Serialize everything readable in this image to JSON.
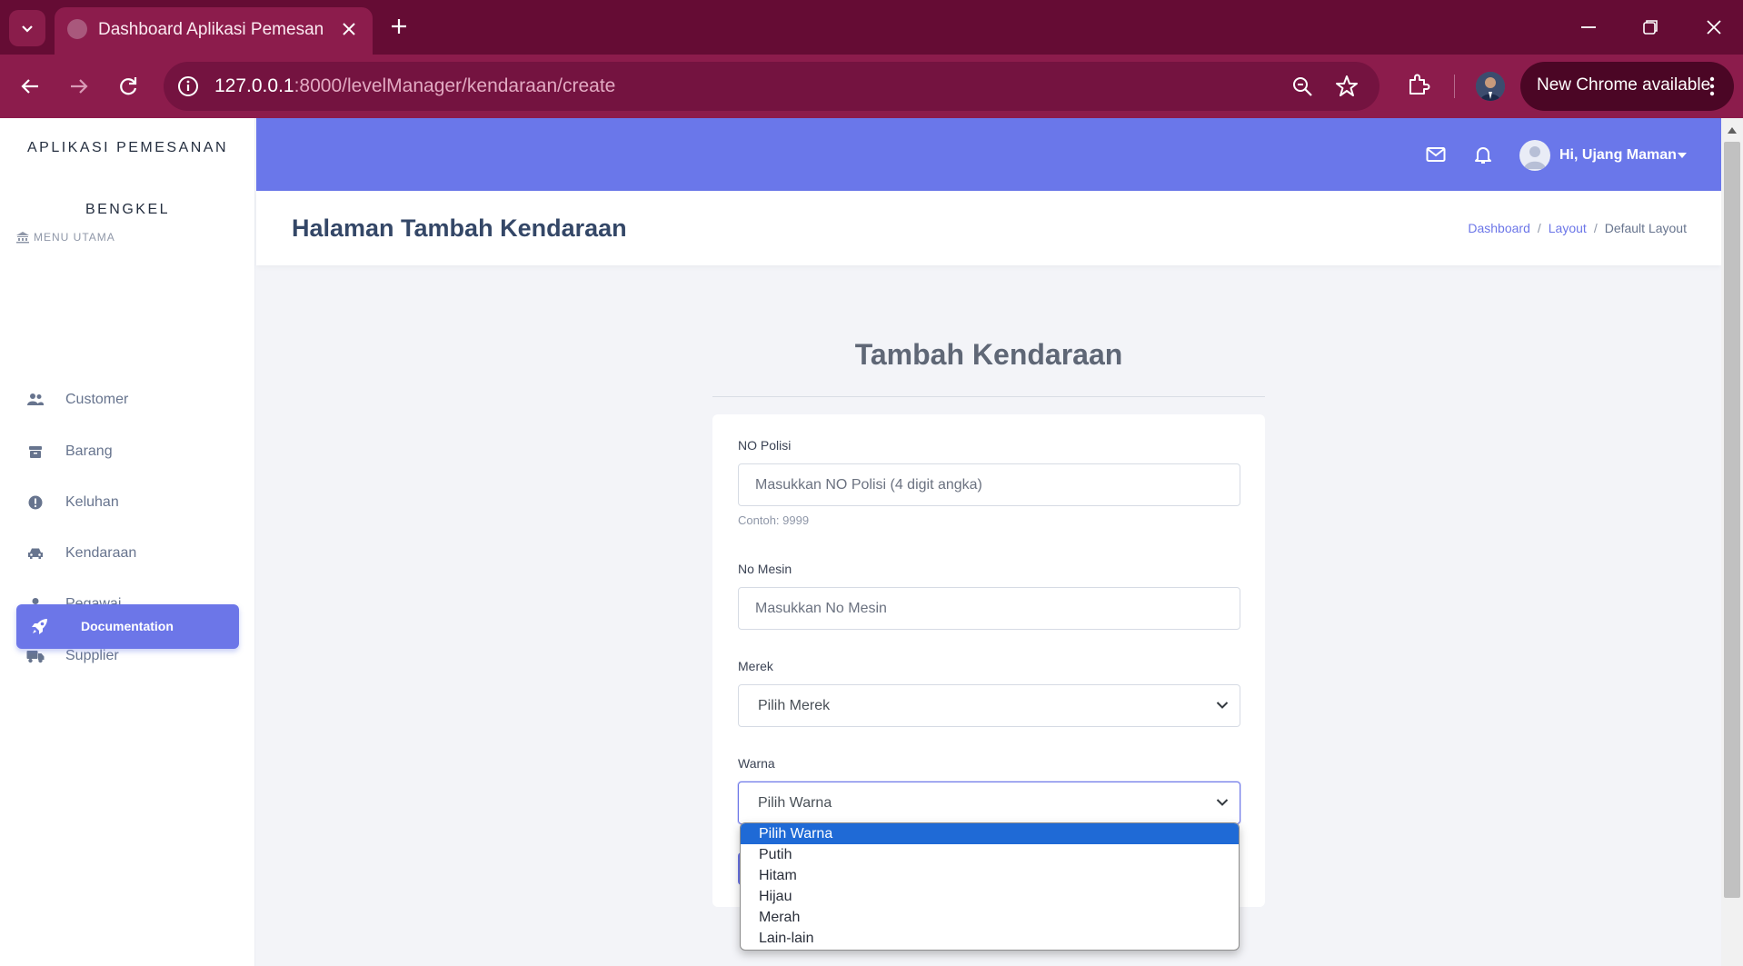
{
  "browser": {
    "tab_title": "Dashboard Aplikasi Pemesanan",
    "url_host": "127.0.0.1",
    "url_rest": ":8000/levelManager/kendaraan/create",
    "update_label": "New Chrome available"
  },
  "sidebar": {
    "brand_line1": "APLIKASI PEMESANAN",
    "brand_line2": "BENGKEL",
    "menu_heading": "MENU UTAMA",
    "items": [
      {
        "label": "Customer",
        "icon": "users-icon"
      },
      {
        "label": "Barang",
        "icon": "box-icon"
      },
      {
        "label": "Keluhan",
        "icon": "alert-circle-icon"
      },
      {
        "label": "Kendaraan",
        "icon": "car-icon"
      },
      {
        "label": "Pegawai",
        "icon": "user-icon"
      },
      {
        "label": "Supplier",
        "icon": "truck-icon"
      }
    ],
    "doc_button": "Documentation"
  },
  "topnav": {
    "user_greeting": "Hi, Ujang Maman"
  },
  "header": {
    "title": "Halaman Tambah Kendaraan",
    "breadcrumb": [
      "Dashboard",
      "Layout",
      "Default Layout"
    ]
  },
  "form": {
    "title": "Tambah Kendaraan",
    "no_polisi": {
      "label": "NO Polisi",
      "placeholder": "Masukkan NO Polisi (4 digit angka)",
      "help": "Contoh: 9999"
    },
    "no_mesin": {
      "label": "No Mesin",
      "placeholder": "Masukkan No Mesin"
    },
    "merek": {
      "label": "Merek",
      "selected": "Pilih Merek"
    },
    "warna": {
      "label": "Warna",
      "selected": "Pilih Warna",
      "options": [
        "Pilih Warna",
        "Putih",
        "Hitam",
        "Hijau",
        "Merah",
        "Lain-lain"
      ]
    }
  },
  "colors": {
    "chrome_dark": "#650c34",
    "chrome_bar": "#8c1c4c",
    "accent": "#6a77ea",
    "select_highlight": "#1f6ad6"
  }
}
